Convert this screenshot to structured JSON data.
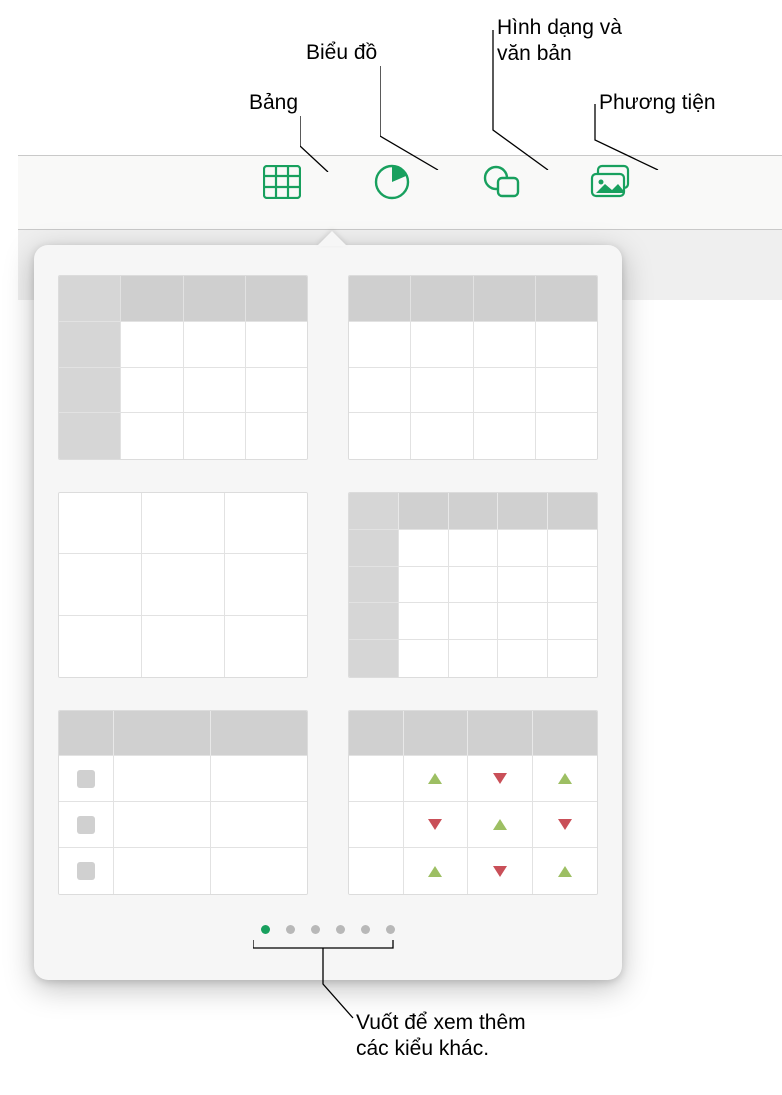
{
  "callouts": {
    "table": "Bảng",
    "chart": "Biểu đồ",
    "shapes_text": "Hình dạng và\nvăn bản",
    "media": "Phương tiện",
    "swipe_hint": "Vuốt để xem thêm\ncác kiểu khác."
  },
  "toolbar": {
    "table_icon": "table-icon",
    "chart_icon": "chart-icon",
    "shapes_icon": "shapes-icon",
    "media_icon": "media-icon"
  },
  "popover": {
    "page_count": 6,
    "active_page": 1
  }
}
